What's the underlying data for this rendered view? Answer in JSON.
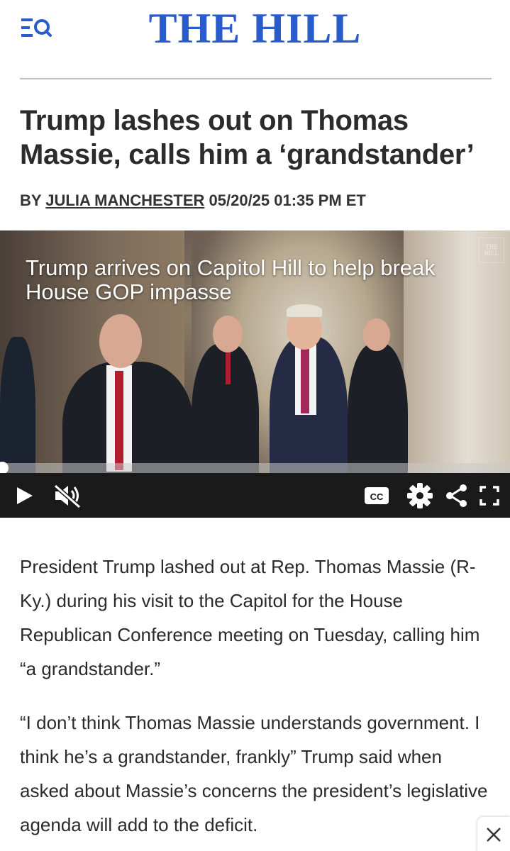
{
  "header": {
    "logo_text": "THE HILL",
    "menu_icon": "menu-search-icon",
    "accent_color": "#2a5cc9"
  },
  "article": {
    "headline": "Trump lashes out on Thomas Massie, calls him a ‘grandstander’",
    "byline_prefix": "BY",
    "author": "JULIA MANCHESTER",
    "datetime": "05/20/25 01:35 PM ET",
    "paragraphs": [
      "President Trump lashed out at Rep. Thomas Massie (R-Ky.) during his visit to the Capitol for the House Republican Conference meeting on Tuesday, calling him “a grandstander.”",
      "“I don’t think Thomas Massie understands government. I think he’s a grandstander, frankly” Trump said when asked about Massie’s concerns the president’s legislative agenda will add to the deficit."
    ]
  },
  "video": {
    "title": "Trump arrives on Capitol Hill to help break House GOP impasse",
    "watermark": "THE HILL",
    "progress": 0.0,
    "controls": {
      "play_icon": "play-icon",
      "mute_icon": "muted-speaker-icon",
      "cc_label": "CC",
      "settings_icon": "gear-icon",
      "share_icon": "share-icon",
      "fullscreen_icon": "fullscreen-icon"
    }
  },
  "overlay": {
    "close_icon": "close-icon"
  }
}
